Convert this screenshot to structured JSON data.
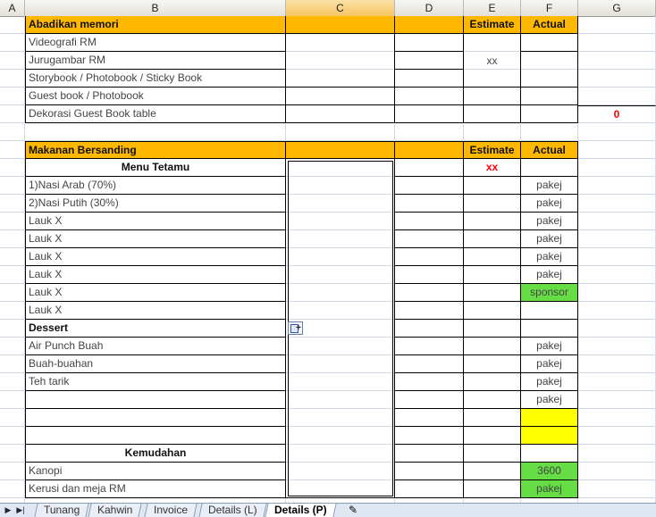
{
  "columns": [
    "A",
    "B",
    "C",
    "D",
    "E",
    "F",
    "G"
  ],
  "section1": {
    "header": "Abadikan memori",
    "estimate": "Estimate",
    "actual": "Actual",
    "items": [
      "Videografi RM",
      "Jurugambar RM",
      "Storybook / Photobook / Sticky Book",
      "Guest book / Photobook",
      "Dekorasi Guest Book table"
    ],
    "estimate_value": "xx",
    "g_value": "0"
  },
  "section2": {
    "header": "Makanan Bersanding",
    "estimate": "Estimate",
    "actual": "Actual",
    "rows": [
      {
        "b": "Menu Tetamu",
        "e": "xx",
        "f": ""
      },
      {
        "b": "1)Nasi Arab (70%)",
        "e": "",
        "f": "pakej"
      },
      {
        "b": "2)Nasi Putih (30%)",
        "e": "",
        "f": "pakej"
      },
      {
        "b": "Lauk X",
        "e": "",
        "f": "pakej"
      },
      {
        "b": "Lauk X",
        "e": "",
        "f": "pakej"
      },
      {
        "b": "Lauk X",
        "e": "",
        "f": "pakej"
      },
      {
        "b": "Lauk X",
        "e": "",
        "f": "pakej"
      },
      {
        "b": "Lauk X",
        "e": "",
        "f": "sponsor"
      },
      {
        "b": "Lauk X",
        "e": "",
        "f": ""
      },
      {
        "b": "Dessert",
        "e": "",
        "f": ""
      },
      {
        "b": "Air Punch Buah",
        "e": "",
        "f": "pakej"
      },
      {
        "b": "Buah-buahan",
        "e": "",
        "f": "pakej"
      },
      {
        "b": "Teh  tarik",
        "e": "",
        "f": "pakej"
      },
      {
        "b": "",
        "e": "",
        "f": "pakej"
      },
      {
        "b": "",
        "e": "",
        "f": ""
      },
      {
        "b": "",
        "e": "",
        "f": ""
      },
      {
        "b": "Kemudahan",
        "e": "",
        "f": ""
      },
      {
        "b": "Kanopi",
        "e": "",
        "f": "3600"
      },
      {
        "b": "Kerusi dan meja RM",
        "e": "",
        "f": "pakej"
      }
    ]
  },
  "tabs": [
    "Tunang",
    "Kahwin",
    "Invoice",
    "Details (L)",
    "Details (P)"
  ],
  "active_tab": "Details (P)",
  "colors": {
    "header_fill": "#ffb800",
    "green_fill": "#66dd44",
    "yellow_fill": "#ffff00",
    "red_text": "#ff0000"
  }
}
